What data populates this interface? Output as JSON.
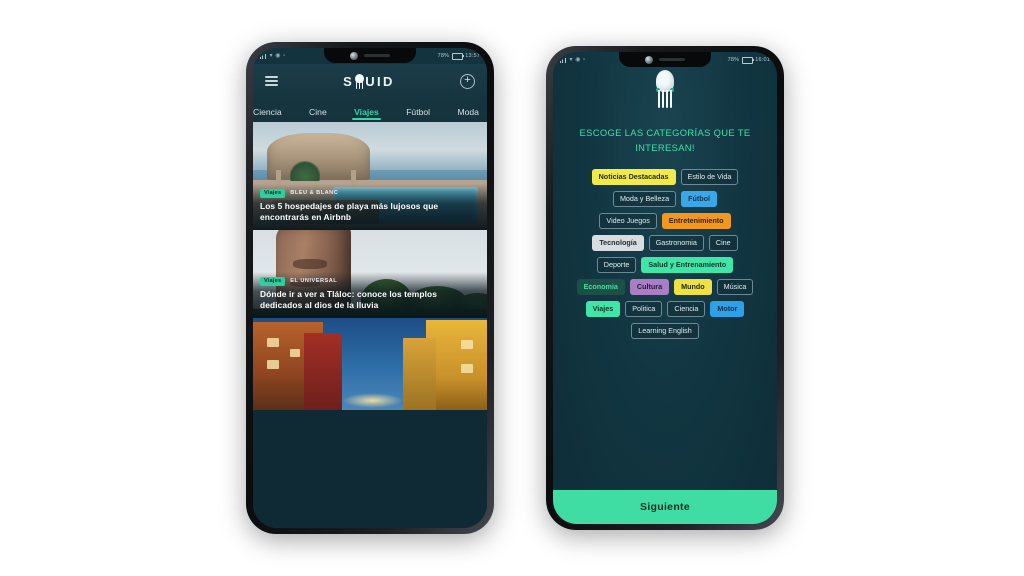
{
  "theme": {
    "bg": "#ffffff",
    "screen_bg": "#13333f",
    "accent_mint": "#35d7a6",
    "accent_button": "#3fdda4",
    "title_color": "#36e3a7"
  },
  "left_phone": {
    "status_bar": {
      "signal_icons": "▰▰ ⊙ ▢",
      "battery_text": "78%",
      "time": "13:57"
    },
    "header": {
      "menu_icon": "hamburger-menu-icon",
      "brand_prefix": "S",
      "brand_suffix": "UID",
      "brand_full": "SQUID",
      "logo_icon": "squid-logo-icon",
      "add_label": "+"
    },
    "tabs": [
      {
        "label": "Ciencia",
        "active": false
      },
      {
        "label": "Cine",
        "active": false
      },
      {
        "label": "Viajes",
        "active": true
      },
      {
        "label": "Fútbol",
        "active": false
      },
      {
        "label": "Moda",
        "active": false
      }
    ],
    "cards": [
      {
        "category": "Viajes",
        "source": "BLEU & BLANC",
        "headline": "Los 5 hospedajes de playa más lujosos que encontrarás en Airbnb",
        "image_desc": "beach-resort-infinity-pool"
      },
      {
        "category": "Viajes",
        "source": "EL UNIVERSAL",
        "headline": "Dónde ir a ver a Tláloc: conoce los templos dedicados al dios de la lluvia",
        "image_desc": "stone-monolith-tlaloc"
      },
      {
        "category": "",
        "source": "",
        "headline": "",
        "image_desc": "colonial-street-night"
      }
    ]
  },
  "right_phone": {
    "status_bar": {
      "signal_icons": "▰▰ ⊙ ▢",
      "battery_text": "78%",
      "time": "16:01"
    },
    "logo_icon": "squid-logo-icon",
    "title": "ESCOGE LAS CATEGORÍAS QUE TE INTERESAN!",
    "chip_rows": [
      [
        {
          "label": "Noticias Destacadas",
          "selected": true,
          "bg": "#f2e94b",
          "fg": "#1f2a10"
        },
        {
          "label": "Estilo de Vida",
          "selected": false,
          "bg": "",
          "fg": ""
        }
      ],
      [
        {
          "label": "Moda y Belleza",
          "selected": false,
          "bg": "",
          "fg": ""
        },
        {
          "label": "Fútbol",
          "selected": true,
          "bg": "#3aa8e8",
          "fg": "#0d3550"
        }
      ],
      [
        {
          "label": "Video Juegos",
          "selected": false,
          "bg": "",
          "fg": ""
        },
        {
          "label": "Entretenimiento",
          "selected": true,
          "bg": "#f2971f",
          "fg": "#3a2203"
        }
      ],
      [
        {
          "label": "Tecnología",
          "selected": true,
          "bg": "#d9dde0",
          "fg": "#1d2b31"
        },
        {
          "label": "Gastronomia",
          "selected": false,
          "bg": "",
          "fg": ""
        },
        {
          "label": "Cine",
          "selected": false,
          "bg": "",
          "fg": ""
        }
      ],
      [
        {
          "label": "Deporte",
          "selected": false,
          "bg": "",
          "fg": ""
        },
        {
          "label": "Salud y Entrenamiento",
          "selected": true,
          "bg": "#3fe6a8",
          "fg": "#0d3327"
        }
      ],
      [
        {
          "label": "Economia",
          "selected": true,
          "bg": "#1c4f45",
          "fg": "#3fe0a0"
        },
        {
          "label": "Cultura",
          "selected": true,
          "bg": "#a87ec4",
          "fg": "#2b1636"
        },
        {
          "label": "Mundo",
          "selected": true,
          "bg": "#efe044",
          "fg": "#25270a"
        },
        {
          "label": "Música",
          "selected": false,
          "bg": "",
          "fg": ""
        }
      ],
      [
        {
          "label": "Viajes",
          "selected": true,
          "bg": "#3fe6a8",
          "fg": "#0d3327"
        },
        {
          "label": "Politica",
          "selected": false,
          "bg": "",
          "fg": ""
        },
        {
          "label": "Ciencia",
          "selected": false,
          "bg": "",
          "fg": ""
        },
        {
          "label": "Motor",
          "selected": true,
          "bg": "#2f9fe8",
          "fg": "#0b3350"
        }
      ],
      [
        {
          "label": "Learning English",
          "selected": false,
          "bg": "",
          "fg": ""
        }
      ]
    ],
    "next_label": "Siguiente"
  }
}
